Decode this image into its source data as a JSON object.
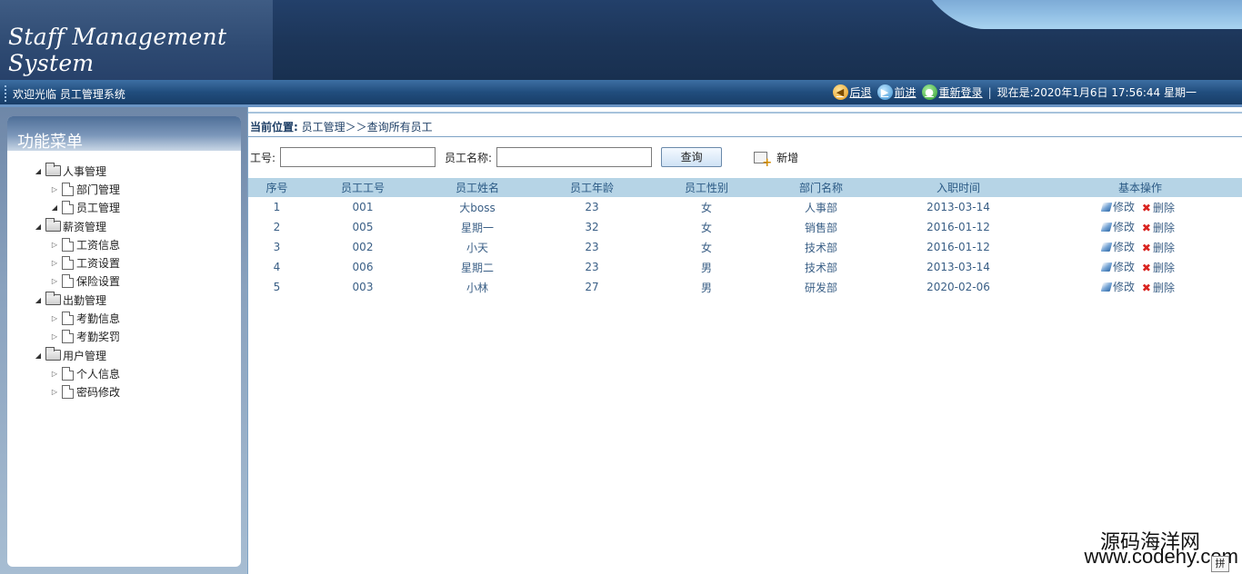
{
  "header": {
    "logo_text": "Staff Management System"
  },
  "topbar": {
    "welcome": "欢迎光临 员工管理系统",
    "back_label": "后退",
    "forward_label": "前进",
    "relogin_label": "重新登录",
    "now_text": "现在是:2020年1月6日 17:56:44 星期一"
  },
  "sidebar": {
    "title": "功能菜单",
    "groups": [
      {
        "label": "人事管理",
        "items": [
          "部门管理",
          "员工管理"
        ]
      },
      {
        "label": "薪资管理",
        "items": [
          "工资信息",
          "工资设置",
          "保险设置"
        ]
      },
      {
        "label": "出勤管理",
        "items": [
          "考勤信息",
          "考勤奖罚"
        ]
      },
      {
        "label": "用户管理",
        "items": [
          "个人信息",
          "密码修改"
        ]
      }
    ]
  },
  "breadcrumb": {
    "prefix": "当前位置:",
    "path": " 员工管理＞＞查询所有员工"
  },
  "search": {
    "id_label": "工号:",
    "name_label": "员工名称:",
    "query_button": "查询",
    "add_button": "新增"
  },
  "table": {
    "headers": [
      "序号",
      "员工工号",
      "员工姓名",
      "员工年龄",
      "员工性别",
      "部门名称",
      "入职时间",
      "基本操作"
    ],
    "edit_label": "修改",
    "delete_label": "删除",
    "rows": [
      [
        "1",
        "001",
        "大boss",
        "23",
        "女",
        "人事部",
        "2013-03-14"
      ],
      [
        "2",
        "005",
        "星期一",
        "32",
        "女",
        "销售部",
        "2016-01-12"
      ],
      [
        "3",
        "002",
        "小天",
        "23",
        "女",
        "技术部",
        "2016-01-12"
      ],
      [
        "4",
        "006",
        "星期二",
        "23",
        "男",
        "技术部",
        "2013-03-14"
      ],
      [
        "5",
        "003",
        "小林",
        "27",
        "男",
        "研发部",
        "2020-02-06"
      ]
    ]
  },
  "watermark": {
    "cn": "源码海洋网",
    "url": "www.codehy.com",
    "ime": "拼"
  }
}
